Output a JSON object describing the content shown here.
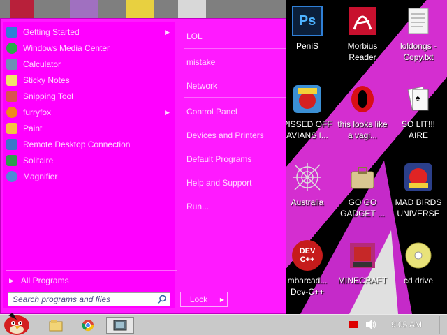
{
  "start_menu": {
    "programs": [
      {
        "label": "Getting Started",
        "icon": "getting-started-icon",
        "color": "#2f7fd6",
        "has_submenu": true
      },
      {
        "label": "Windows Media Center",
        "icon": "media-center-icon",
        "color": "#2aa84a",
        "has_submenu": false
      },
      {
        "label": "Calculator",
        "icon": "calculator-icon",
        "color": "#6f8fb5",
        "has_submenu": false
      },
      {
        "label": "Sticky Notes",
        "icon": "sticky-notes-icon",
        "color": "#f3e36a",
        "has_submenu": false
      },
      {
        "label": "Snipping Tool",
        "icon": "snipping-tool-icon",
        "color": "#d9534f",
        "has_submenu": false
      },
      {
        "label": "furryfox",
        "icon": "furryfox-icon",
        "color": "#f08a1c",
        "has_submenu": true
      },
      {
        "label": "Paint",
        "icon": "paint-icon",
        "color": "#f5c242",
        "has_submenu": false
      },
      {
        "label": "Remote Desktop Connection",
        "icon": "remote-desktop-icon",
        "color": "#3a78c9",
        "has_submenu": false
      },
      {
        "label": "Solitaire",
        "icon": "solitaire-icon",
        "color": "#2f9c4f",
        "has_submenu": false
      },
      {
        "label": "Magnifier",
        "icon": "magnifier-icon",
        "color": "#4f8ad6",
        "has_submenu": false
      }
    ],
    "all_programs": "All Programs",
    "search_placeholder": "Search programs and files",
    "right_links": [
      "LOL",
      "mistake",
      "Network",
      "Control Panel",
      "Devices and Printers",
      "Default Programs",
      "Help and Support",
      "Run..."
    ],
    "lock_label": "Lock"
  },
  "desktop_icons": [
    {
      "label": "PeniS",
      "icon": "photoshop-icon",
      "art": "Ps"
    },
    {
      "label": "Morbius Reader",
      "icon": "pdf-reader-icon",
      "art": ""
    },
    {
      "label": "loldongs - Copy.txt",
      "icon": "text-file-icon",
      "art": ""
    },
    {
      "label": "PISSED OFF AVIANS I...",
      "icon": "angry-birds-seasons-icon",
      "art": ""
    },
    {
      "label": "this looks like a vagi...",
      "icon": "opera-icon",
      "art": ""
    },
    {
      "label": "SO LIT!!! AIRE",
      "icon": "solitaire-cards-icon",
      "art": ""
    },
    {
      "label": "Australia",
      "icon": "spider-web-icon",
      "art": ""
    },
    {
      "label": "GO GO GADGET ...",
      "icon": "briefcase-icon",
      "art": ""
    },
    {
      "label": "MAD BIRDS UNIVERSE",
      "icon": "angry-birds-space-icon",
      "art": ""
    },
    {
      "label": "mbarcad... Dev-C++",
      "icon": "dev-cpp-icon",
      "art": "DEV C++"
    },
    {
      "label": "MINECRAFT",
      "icon": "minecraft-icon",
      "art": ""
    },
    {
      "label": "cd drive",
      "icon": "cd-drive-icon",
      "art": ""
    }
  ],
  "taskbar": {
    "clock": "9:05 AM",
    "items": [
      "explorer-icon",
      "chrome-icon",
      "media-icon"
    ]
  },
  "colors": {
    "menu_bg": "#ff00ff",
    "taskbar_bg": "#c9c9c9"
  }
}
